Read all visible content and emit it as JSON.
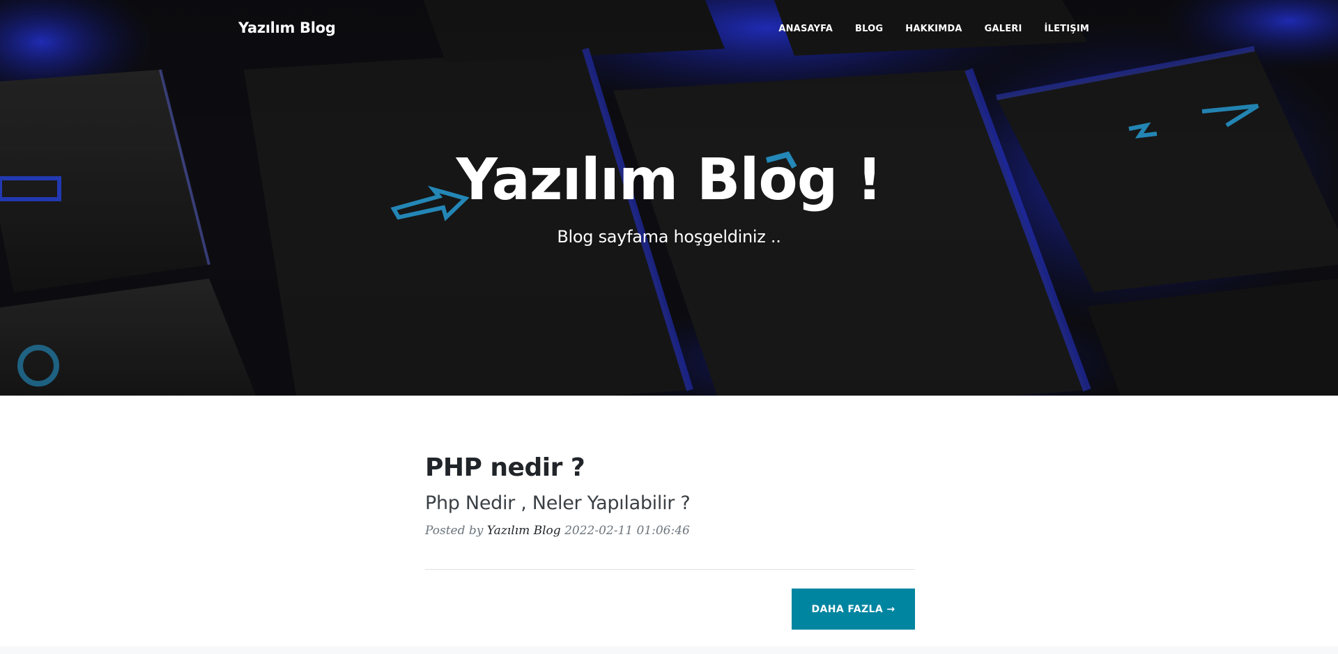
{
  "nav": {
    "brand": "Yazılım Blog",
    "links": [
      "ANASAYFA",
      "BLOG",
      "HAKKIMDA",
      "GALERI",
      "İLETIŞIM"
    ]
  },
  "hero": {
    "title": "Yazılım Blog !",
    "subtitle": "Blog sayfama hoşgeldiniz .."
  },
  "post": {
    "title": "PHP nedir ?",
    "subtitle": "Php Nedir , Neler Yapılabilir ?",
    "meta_prefix": "Posted by",
    "author": "Yazılım Blog",
    "date": "2022-02-11 01:06:46"
  },
  "more_button": "DAHA FAZLA →",
  "colors": {
    "accent": "#0085a1",
    "hero_bg": "#121212",
    "key_glow": "#1e2fd8"
  }
}
